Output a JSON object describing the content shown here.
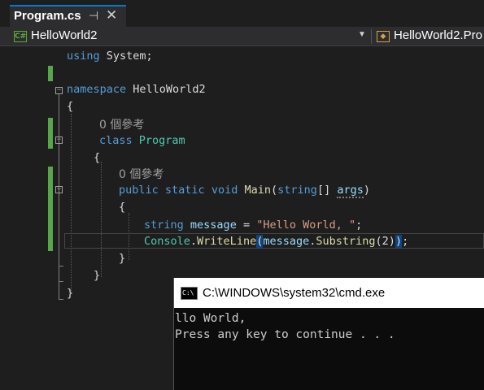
{
  "tab": {
    "label": "Program.cs",
    "pin_icon": "pin-icon",
    "close_icon": "close-icon"
  },
  "navbar": {
    "project": "HelloWorld2",
    "class_path": "HelloWorld2.Pro"
  },
  "code": {
    "line1_kw": "using",
    "line1_rest": " System;",
    "ns_kw": "namespace",
    "ns_name": " HelloWorld2",
    "open_brace": "{",
    "refs1": "0 個參考",
    "class_kw": "class",
    "class_name": "Program",
    "refs2": "0 個參考",
    "m_public": "public",
    "m_static": "static",
    "m_void": "void",
    "m_name": "Main",
    "m_string": "string",
    "m_arr": "[] ",
    "m_args": "args",
    "m_close": ")",
    "s_type": "string",
    "s_var": "message",
    "s_eq": " = ",
    "s_val": "\"Hello World, \"",
    "s_end": ";",
    "c_type": "Console",
    "c_dot": ".",
    "c_meth": "WriteLine",
    "c_open": "(",
    "c_var": "message",
    "c_dot2": ".",
    "c_meth2": "Substring",
    "c_arg": "(2)",
    "c_close": ")",
    "c_end": ";",
    "close_brace": "}"
  },
  "console": {
    "title": "C:\\WINDOWS\\system32\\cmd.exe",
    "icon": "cmd-icon",
    "output_line1": "llo World,",
    "output_line2": "Press any key to continue . . ."
  },
  "colors": {
    "keyword": "#569cd6",
    "type": "#4ec9b0",
    "string": "#d69d85",
    "accent": "#007acc"
  }
}
